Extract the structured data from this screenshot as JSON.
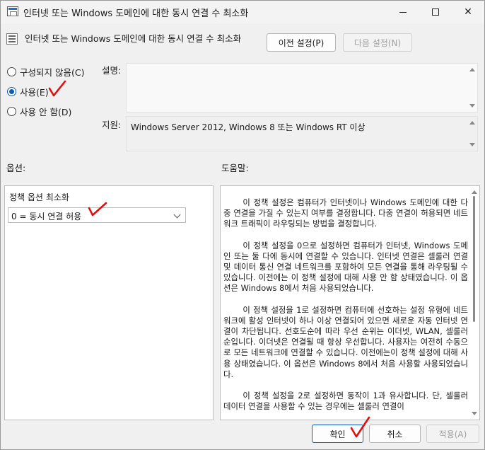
{
  "window": {
    "title": "인터넷 또는 Windows 도메인에 대한 동시 연결 수 최소화"
  },
  "header": {
    "title": "인터넷 또는 Windows 도메인에 대한 동시 연결 수 최소화",
    "prev_label": "이전 설정(P)",
    "next_label": "다음 설정(N)"
  },
  "state": {
    "options": [
      {
        "label": "구성되지 않음(C)",
        "selected": false
      },
      {
        "label": "사용(E)",
        "selected": true
      },
      {
        "label": "사용 안 함(D)",
        "selected": false
      }
    ]
  },
  "description": {
    "label": "설명:",
    "text": ""
  },
  "supported": {
    "label": "지원:",
    "text": "Windows Server 2012, Windows 8 또는 Windows RT 이상"
  },
  "options_pane": {
    "label": "옵션:",
    "policy_label": "정책 옵션 최소화",
    "dropdown_value": "0 = 동시 연결 허용"
  },
  "help_pane": {
    "label": "도움말:",
    "paragraphs": [
      "이 정책 설정은 컴퓨터가 인터넷이나 Windows 도메인에 대한 다중 연결을 가질 수 있는지 여부를 결정합니다. 다중 연결이 허용되면 네트워크 트래픽이 라우팅되는 방법을 결정합니다.",
      "이 정책 설정을 0으로 설정하면 컴퓨터가 인터넷, Windows 도메인 또는 둘 다에 동시에 연결할 수 있습니다. 인터넷 연결은 셀룰러 연결 및 데이터 통신 연결 네트워크를 포함하여 모든 연결을 통해 라우팅될 수 있습니다. 이전에는 이 정책 설정에 대해 사용 안 함 상태였습니다. 이 옵션은 Windows 8에서 처음 사용되었습니다.",
      "이 정책 설정을 1로 설정하면 컴퓨터에 선호하는 설정 유형에 네트워크에 활성 인터넷이 하나 이상 연결되어 있으면 새로운 자동 인터넷 연결이 차단됩니다. 선호도순에 따라 우선 순위는 이더넷, WLAN, 셀룰러 순입니다. 이더넷은 연결될 때 항상 우선합니다. 사용자는 여전히 수동으로 모든 네트워크에 연결할 수 있습니다. 이전에는이 정책 설정에 대해 사용 상태였습니다. 이 옵션은 Windows 8에서 처음 사용할 사용되었습니다.",
      "이 정책 설정을 2로 설정하면 동작이 1과 유사합니다. 단, 셀룰러 데이터 연결을 사용할 수 있는 경우에는 셀룰러 연결이"
    ]
  },
  "footer": {
    "ok_label": "확인",
    "cancel_label": "취소",
    "apply_label": "적용(A)"
  },
  "annotations": {
    "color": "#e01010"
  }
}
